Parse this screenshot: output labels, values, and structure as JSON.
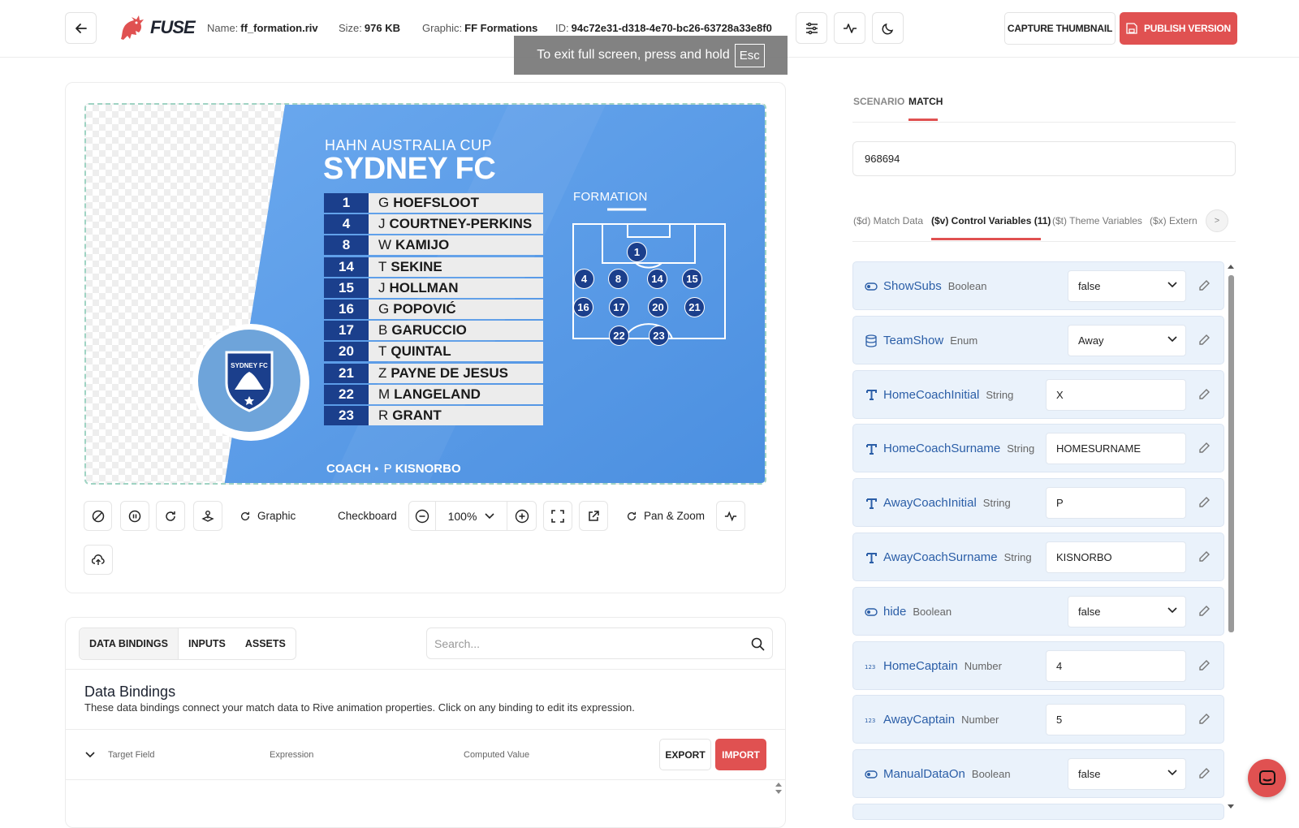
{
  "header": {
    "brand": "FUSE",
    "name_label": "Name:",
    "name_value": "ff_formation.riv",
    "size_label": "Size:",
    "size_value": "976 KB",
    "graphic_label": "Graphic:",
    "graphic_value": "FF Formations",
    "id_label": "ID:",
    "id_value": "94c72e31-d318-4e70-bc26-63728a33e8f0",
    "capture_label": "CAPTURE THUMBNAIL",
    "publish_label": "PUBLISH VERSION",
    "colors": {
      "accent": "#e05151",
      "text": "#222222"
    }
  },
  "toast": {
    "text": "To exit full screen, press and hold",
    "key": "Esc"
  },
  "preview": {
    "cup": "HAHN AUSTRALIA CUP",
    "team": "SYDNEY FC",
    "badge_text": "SYDNEY FC",
    "formation_label": "FORMATION",
    "roster": [
      {
        "num": "1",
        "initial": "G",
        "surname": "HOEFSLOOT"
      },
      {
        "num": "4",
        "initial": "J",
        "surname": "COURTNEY-PERKINS"
      },
      {
        "num": "8",
        "initial": "W",
        "surname": "KAMIJO"
      },
      {
        "num": "14",
        "initial": "T",
        "surname": "SEKINE"
      },
      {
        "num": "15",
        "initial": "J",
        "surname": "HOLLMAN"
      },
      {
        "num": "16",
        "initial": "G",
        "surname": "POPOVIĆ"
      },
      {
        "num": "17",
        "initial": "B",
        "surname": "GARUCCIO"
      },
      {
        "num": "20",
        "initial": "T",
        "surname": "QUINTAL"
      },
      {
        "num": "21",
        "initial": "Z",
        "surname": "PAYNE DE JESUS"
      },
      {
        "num": "22",
        "initial": "M",
        "surname": "LANGELAND"
      },
      {
        "num": "23",
        "initial": "R",
        "surname": "GRANT"
      }
    ],
    "pitch_numbers": [
      "1",
      "4",
      "8",
      "14",
      "15",
      "16",
      "17",
      "20",
      "21",
      "22",
      "23"
    ],
    "coach_label": "COACH",
    "coach_initial": "P",
    "coach_surname": "KISNORBO",
    "colors": {
      "primary": "#5c9de8",
      "navy": "#1b3f8c"
    }
  },
  "toolbar": {
    "graphic_label": "Graphic",
    "checkboard_label": "Checkboard",
    "zoom_value": "100%",
    "pan_zoom_label": "Pan & Zoom"
  },
  "bottom": {
    "tabs": [
      "DATA BINDINGS",
      "INPUTS",
      "ASSETS"
    ],
    "search_placeholder": "Search...",
    "title": "Data Bindings",
    "description": "These data bindings connect your match data to Rive animation properties. Click on any binding to edit its expression.",
    "columns": [
      "Target Field",
      "Expression",
      "Computed Value"
    ],
    "export_label": "EXPORT",
    "import_label": "IMPORT"
  },
  "right": {
    "tabs": [
      "SCENARIO",
      "MATCH"
    ],
    "match_id": "968694",
    "var_tabs": [
      "($d) Match Data",
      "($v) Control Variables (11)",
      "($t) Theme Variables",
      "($x) Extern"
    ],
    "next_label": ">",
    "variables": [
      {
        "name": "ShowSubs",
        "type": "Boolean",
        "value": "false",
        "kind": "select",
        "icon": "toggle-icon"
      },
      {
        "name": "TeamShow",
        "type": "Enum",
        "value": "Away",
        "kind": "select",
        "icon": "database-icon"
      },
      {
        "name": "HomeCoachInitial",
        "type": "String",
        "value": "X",
        "kind": "text",
        "icon": "text-icon"
      },
      {
        "name": "HomeCoachSurname",
        "type": "String",
        "value": "HOMESURNAME",
        "kind": "text",
        "icon": "text-icon"
      },
      {
        "name": "AwayCoachInitial",
        "type": "String",
        "value": "P",
        "kind": "text",
        "icon": "text-icon"
      },
      {
        "name": "AwayCoachSurname",
        "type": "String",
        "value": "KISNORBO",
        "kind": "text",
        "icon": "text-icon"
      },
      {
        "name": "hide",
        "type": "Boolean",
        "value": "false",
        "kind": "select",
        "icon": "toggle-icon"
      },
      {
        "name": "HomeCaptain",
        "type": "Number",
        "value": "4",
        "kind": "text",
        "icon": "number-icon"
      },
      {
        "name": "AwayCaptain",
        "type": "Number",
        "value": "5",
        "kind": "text",
        "icon": "number-icon"
      },
      {
        "name": "ManualDataOn",
        "type": "Boolean",
        "value": "false",
        "kind": "select",
        "icon": "toggle-icon"
      }
    ]
  }
}
